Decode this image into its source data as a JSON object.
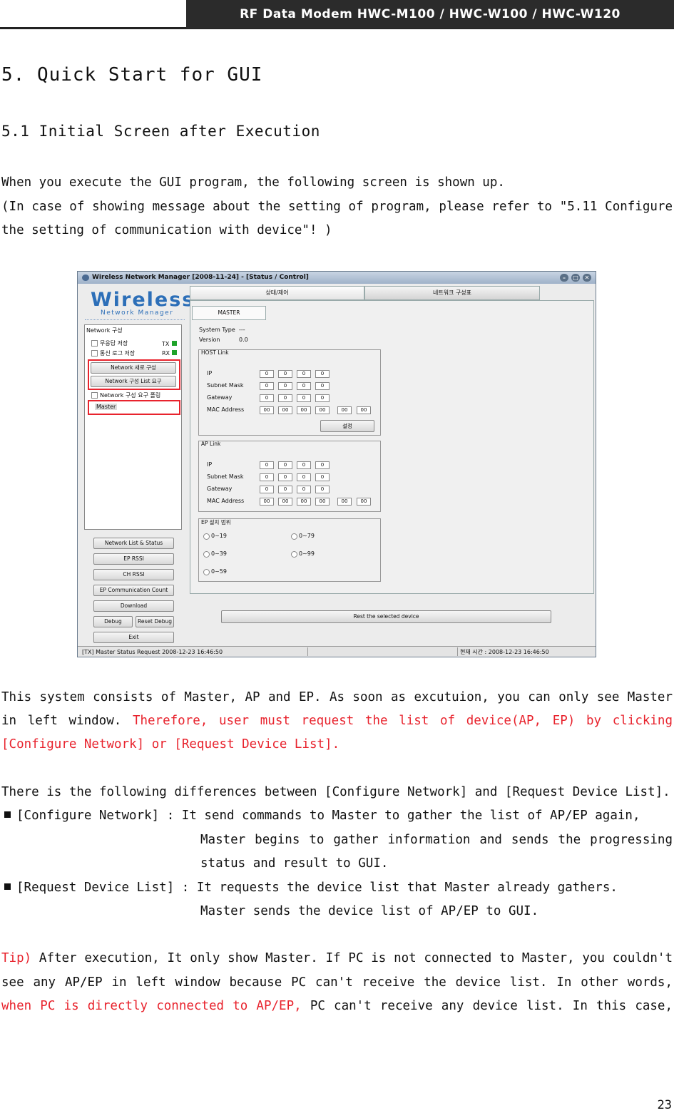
{
  "header": {
    "title": "RF Data Modem HWC-M100 / HWC-W100 / HWC-W120"
  },
  "section": {
    "title": "5. Quick Start for GUI",
    "subtitle": "5.1 Initial Screen after Execution"
  },
  "intro": {
    "line1": " When you execute the GUI program, the following screen is shown up.",
    "line2": "(In case of showing message about the setting of program, please refer to \"5.11 Configure",
    "line3": "the setting of communication with device\"! )"
  },
  "app": {
    "window_title": "Wireless Network Manager [2008-11-24] - [Status / Control]",
    "logo_main": "Wireless",
    "logo_sub": "Network Manager",
    "network_group": "Network 구성",
    "chk_response": "무응답 저장",
    "chk_log": "통신 로그 저장",
    "tx": "TX",
    "rx": "RX",
    "btn_configure": "Network 새로 구성",
    "btn_request_list": "Network 구성 List 요구",
    "chk_polling": "Network 구성 요구 폴링",
    "tree_master": "Master",
    "btn_list_status": "Network List & Status",
    "btn_ep_rssi": "EP RSSI",
    "btn_ch_rssi": "CH RSSI",
    "btn_ep_comm": "EP Communication Count",
    "btn_download": "Download",
    "btn_debug": "Debug",
    "btn_reset_debug": "Reset Debug",
    "btn_exit": "Exit",
    "tab_status": "상태/제어",
    "tab_network": "네트워크 구성표",
    "subtab_master": "MASTER",
    "system_type_label": "System Type",
    "system_type_value": "---",
    "version_label": "Version",
    "version_value": "0.0",
    "host_link": "HOST Link",
    "ap_link": "AP Link",
    "ip": "IP",
    "subnet": "Subnet Mask",
    "gateway": "Gateway",
    "mac": "MAC Address",
    "zero": "0",
    "zz": "00",
    "btn_set": "설정",
    "ep_range": "EP 설치 범위",
    "r1": "0~19",
    "r2": "0~39",
    "r3": "0~59",
    "r4": "0~79",
    "r5": "0~99",
    "btn_reset_device": "Rest the selected device",
    "status_left": "[TX] Master  Status Request 2008-12-23 16:46:50",
    "status_right": "현재 시간 : 2008-12-23 16:46:50"
  },
  "body": {
    "p1a": "This system consists of Master, AP and EP. As soon as excutuion, you can only see Master",
    "p1b_plain": "in  left  window.  ",
    "p1b_red": "Therefore,  user  must  request  the  list  of  device(AP,  EP)  by  clicking",
    "p1c_red": "[Configure Network] or [Request Device List].",
    "p2": "There is the following differences between [Configure Network] and [Request Device List].",
    "b1_label": "[Configure Network]   : ",
    "b1_text": "It send commands to Master to gather the list of AP/EP again,",
    "b1_cont1": "Master  begins  to  gather  information  and  sends  the  progressing",
    "b1_cont2": "status and result to GUI.",
    "b2_label": "[Request Device List] : ",
    "b2_text": "It requests the device list that Master already gathers.",
    "b2_cont1": "Master sends the device list of AP/EP to GUI.",
    "tip_red": "Tip)",
    "tip_a": " After execution, It only show Master. If PC is not connected to Master, you couldn't",
    "tip_b": "see  any  AP/EP  in  left  window  because  PC  can't  receive  the  device  list.  In  other  words,",
    "tip_c_red": "when  PC  is  directly  connected  to  AP/EP,",
    "tip_c": " PC  can't  receive  any  device  list.  In  this  case,"
  },
  "page_number": "23"
}
